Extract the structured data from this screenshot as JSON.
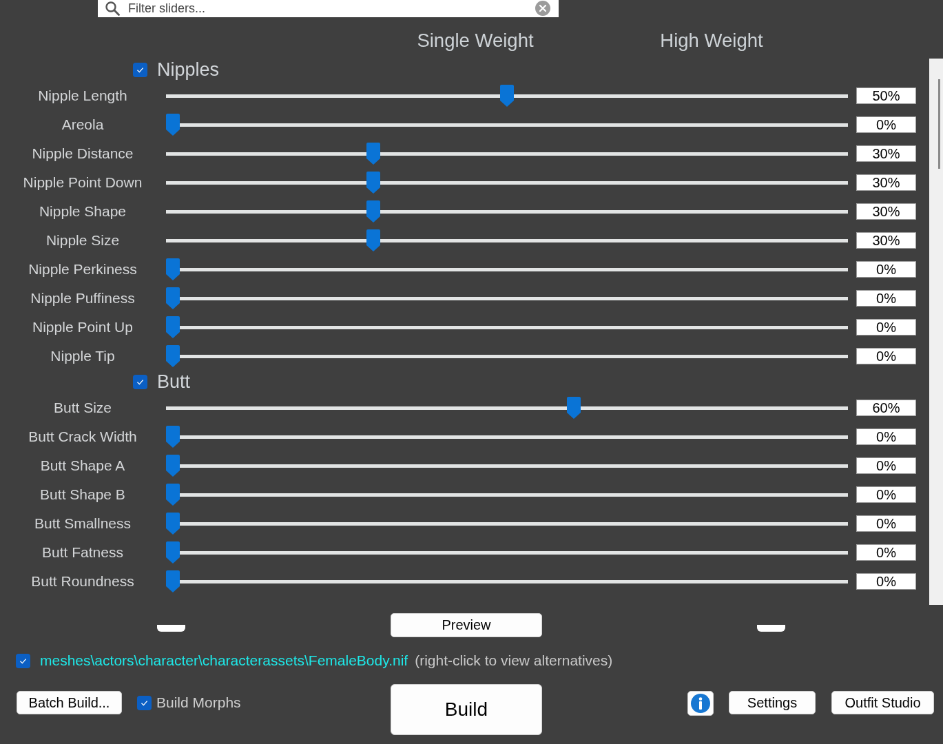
{
  "filter": {
    "placeholder": "Filter sliders..."
  },
  "columns": [
    "Single Weight",
    "High Weight"
  ],
  "groups": [
    {
      "name": "Nipples",
      "checked": true,
      "sliders": [
        {
          "name": "Nipple Length",
          "level": 0.5,
          "value": "50%"
        },
        {
          "name": "Areola",
          "level": 0,
          "value": "0%"
        },
        {
          "name": "Nipple Distance",
          "level": 0.3,
          "value": "30%"
        },
        {
          "name": "Nipple Point Down",
          "level": 0.3,
          "value": "30%"
        },
        {
          "name": "Nipple Shape",
          "level": 0.3,
          "value": "30%"
        },
        {
          "name": "Nipple Size",
          "level": 0.3,
          "value": "30%"
        },
        {
          "name": "Nipple Perkiness",
          "level": 0,
          "value": "0%"
        },
        {
          "name": "Nipple Puffiness",
          "level": 0,
          "value": "0%"
        },
        {
          "name": "Nipple Point Up",
          "level": 0,
          "value": "0%"
        },
        {
          "name": "Nipple Tip",
          "level": 0,
          "value": "0%"
        }
      ]
    },
    {
      "name": "Butt",
      "checked": true,
      "sliders": [
        {
          "name": "Butt Size",
          "level": 0.6,
          "value": "60%"
        },
        {
          "name": "Butt Crack Width",
          "level": 0,
          "value": "0%"
        },
        {
          "name": "Butt Shape A",
          "level": 0,
          "value": "0%"
        },
        {
          "name": "Butt Shape B",
          "level": 0,
          "value": "0%"
        },
        {
          "name": "Butt Smallness",
          "level": 0,
          "value": "0%"
        },
        {
          "name": "Butt Fatness",
          "level": 0,
          "value": "0%"
        },
        {
          "name": "Butt Roundness",
          "level": 0,
          "value": "0%"
        }
      ]
    }
  ],
  "preview_button": "Preview",
  "output": {
    "checked": true,
    "path": "meshes\\actors\\character\\characterassets\\FemaleBody.nif",
    "hint": "(right-click to view alternatives)"
  },
  "batch_build_button": "Batch Build...",
  "build_morphs": {
    "label": "Build Morphs",
    "checked": true
  },
  "build_button": "Build",
  "settings_button": "Settings",
  "outfit_studio_button": "Outfit Studio"
}
